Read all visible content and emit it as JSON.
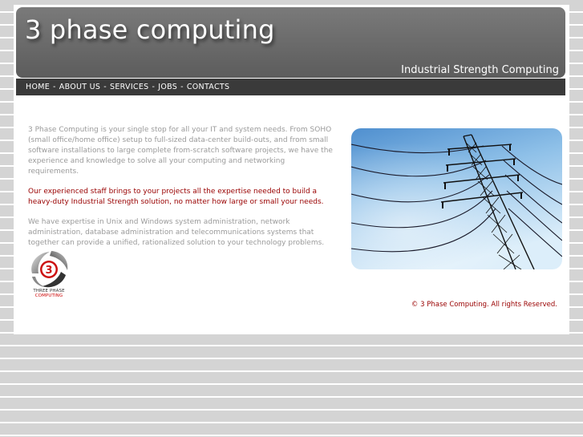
{
  "header": {
    "title": "3 phase computing",
    "tagline": "Industrial Strength Computing"
  },
  "nav": {
    "items": [
      {
        "label": "HOME"
      },
      {
        "label": "ABOUT US"
      },
      {
        "label": "SERVICES"
      },
      {
        "label": "JOBS"
      },
      {
        "label": "CONTACTS"
      }
    ],
    "separator": "-"
  },
  "content": {
    "intro": "3 Phase Computing is your single stop for all your IT and system needs. From SOHO (small office/home office) setup to full-sized data-center build-outs, and from small software installations to large complete from-scratch software projects, we have the experience and knowledge to solve all your computing and networking requirements.",
    "highlight": "Our experienced staff brings to your projects all the expertise needed to build a heavy-duty Industrial Strength solution, no matter how large or small your needs.",
    "expertise": "We have expertise in Unix and Windows system administration, network administration, database administration and telecommunications systems that together can provide a unified, rationalized solution to your technology problems."
  },
  "logo": {
    "numeral": "3",
    "line1": "THREE PHASE",
    "line2": "COMPUTING"
  },
  "hero": {
    "icon": "power-pylon-image"
  },
  "footer": {
    "copyright": "© 3 Phase Computing. All rights Reserved."
  },
  "colors": {
    "header_bg": "#6a6a6a",
    "nav_bg": "#3a3a3a",
    "accent_red": "#990000",
    "body_text": "#9a9a9a"
  }
}
